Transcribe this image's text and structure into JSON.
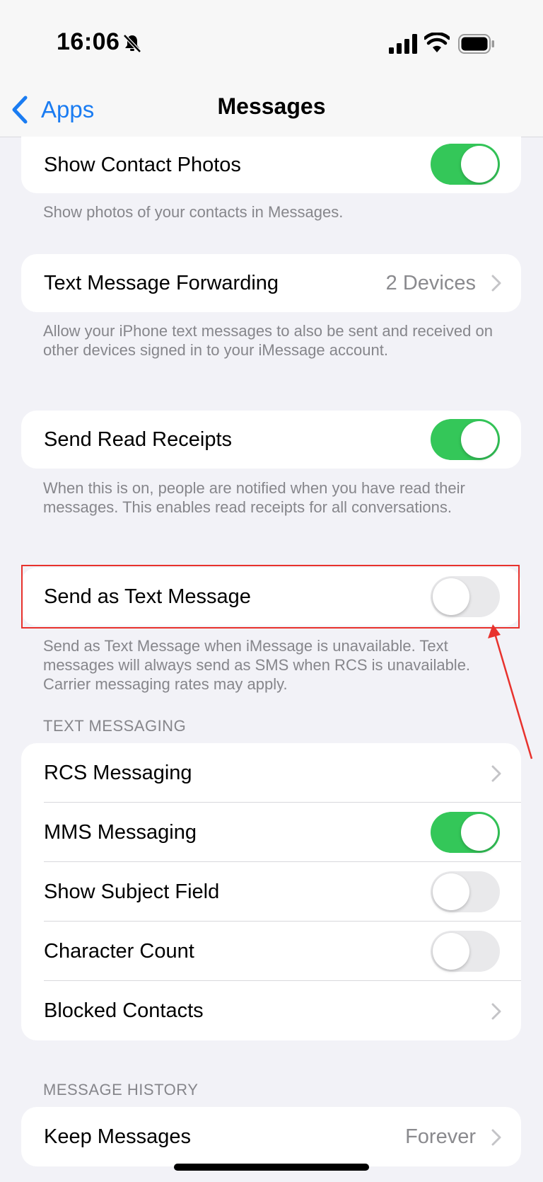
{
  "status_bar": {
    "time": "16:06"
  },
  "nav": {
    "back_label": "Apps",
    "title": "Messages"
  },
  "contact_photos": {
    "label": "Show Contact Photos",
    "enabled": true,
    "footer": "Show photos of your contacts in Messages."
  },
  "forwarding": {
    "label": "Text Message Forwarding",
    "value": "2 Devices",
    "footer": "Allow your iPhone text messages to also be sent and received on other devices signed in to your iMessage account."
  },
  "read_receipts": {
    "label": "Send Read Receipts",
    "enabled": true,
    "footer": "When this is on, people are notified when you have read their messages. This enables read receipts for all conversations."
  },
  "send_as_text": {
    "label": "Send as Text Message",
    "enabled": false,
    "footer": "Send as Text Message when iMessage is unavailable. Text messages will always send as SMS when RCS is unavailable. Carrier messaging rates may apply."
  },
  "text_messaging": {
    "header": "TEXT MESSAGING",
    "rcs_label": "RCS Messaging",
    "mms_label": "MMS Messaging",
    "mms_enabled": true,
    "subject_label": "Show Subject Field",
    "subject_enabled": false,
    "char_count_label": "Character Count",
    "char_count_enabled": false,
    "blocked_label": "Blocked Contacts"
  },
  "message_history": {
    "header": "MESSAGE HISTORY",
    "keep_label": "Keep Messages",
    "keep_value": "Forever"
  },
  "colors": {
    "accent": "#1a7cf2",
    "toggle_on": "#34c759",
    "annotation": "#e8322d"
  }
}
